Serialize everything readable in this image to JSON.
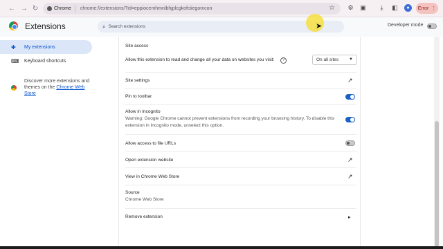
{
  "browser": {
    "chip_label": "Chrome",
    "url": "chrome://extensions/?id=eppiocemhmnlbhjplcgkofciiegomcon",
    "error_label": "Error"
  },
  "header": {
    "title": "Extensions",
    "search_placeholder": "Search extensions",
    "dev_mode_label": "Developer mode"
  },
  "sidebar": {
    "items": [
      {
        "label": "My extensions"
      },
      {
        "label": "Keyboard shortcuts"
      }
    ],
    "promo_text": "Discover more extensions and themes on the ",
    "promo_link": "Chrome Web Store"
  },
  "details": {
    "site_access_title": "Site access",
    "site_access_desc": "Allow this extension to read and change all your data on websites you visit:",
    "site_access_value": "On all sites",
    "site_settings": "Site settings",
    "pin_to_toolbar": "Pin to toolbar",
    "incognito_title": "Allow in Incognito",
    "incognito_warning": "Warning: Google Chrome cannot prevent extensions from recording your browsing history. To disable this extension in Incognito mode, unselect this option.",
    "file_urls": "Allow access to file URLs",
    "open_website": "Open extension website",
    "view_store": "View in Chrome Web Store",
    "source_title": "Source",
    "source_value": "Chrome Web Store",
    "remove": "Remove extension"
  },
  "colors": {
    "accent": "#1a62c6",
    "active_nav_bg": "#dbe6f8"
  }
}
